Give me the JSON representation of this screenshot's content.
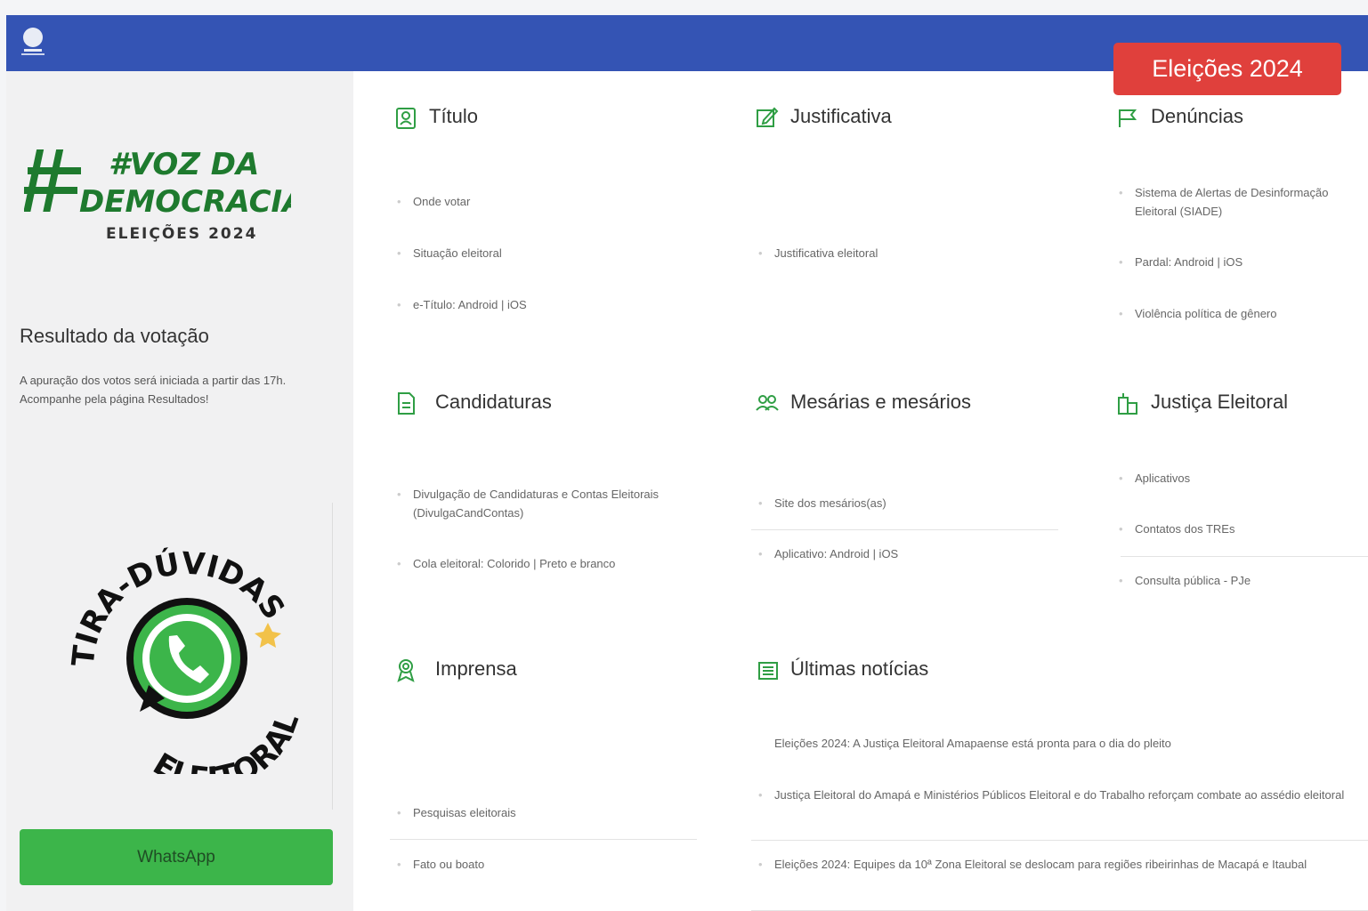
{
  "badge": "Eleições 2024",
  "sidebar": {
    "campaign_title_1": "#VOZ DA",
    "campaign_title_2": "DEMOCRACIA",
    "campaign_sub": "ELEIÇÕES 2024",
    "result_title": "Resultado da votação",
    "result_text": "A apuração dos votos será iniciada a partir das 17h. Acompanhe pela página Resultados!",
    "wa_top": "TIRA-DÚVIDAS",
    "wa_bottom": "ELEITORAL",
    "wa_button": "WhatsApp"
  },
  "cards": {
    "titulo": {
      "title": "Título",
      "items": [
        "Onde votar",
        "Situação eleitoral",
        "e-Título: Android | iOS"
      ]
    },
    "justificativa": {
      "title": "Justificativa",
      "items": [
        "Justificativa eleitoral"
      ]
    },
    "denuncias": {
      "title": "Denúncias",
      "items": [
        "Sistema de Alertas de Desinformação Eleitoral (SIADE)",
        "Pardal: Android | iOS",
        "Violência política de gênero"
      ]
    },
    "candidaturas": {
      "title": "Candidaturas",
      "items": [
        "Divulgação de Candidaturas e Contas Eleitorais (DivulgaCandContas)",
        "Cola eleitoral: Colorido | Preto e branco"
      ]
    },
    "mesarios": {
      "title": "Mesárias e mesários",
      "items": [
        "Site dos mesários(as)",
        "Aplicativo: Android | iOS"
      ]
    },
    "justica": {
      "title": "Justiça Eleitoral",
      "items": [
        "Aplicativos",
        "Contatos dos TREs",
        "Consulta pública - PJe"
      ]
    },
    "imprensa": {
      "title": "Imprensa",
      "items": [
        "Pesquisas eleitorais",
        "Fato ou boato"
      ]
    },
    "noticias": {
      "title": "Últimas notícias",
      "items": [
        "Eleições 2024: A Justiça Eleitoral Amapaense está pronta para o dia do pleito",
        "Justiça Eleitoral do Amapá e Ministérios Públicos Eleitoral e do Trabalho reforçam combate ao assédio eleitoral",
        "Eleições 2024: Equipes da 10ª Zona Eleitoral se deslocam para regiões ribeirinhas de Macapá e Itaubal"
      ]
    }
  },
  "colors": {
    "header": "#3454b4",
    "badge": "#e0403c",
    "whatsapp": "#3cb54a",
    "campaign_green": "#1e7a2e",
    "icon_green": "#2f9e44"
  }
}
